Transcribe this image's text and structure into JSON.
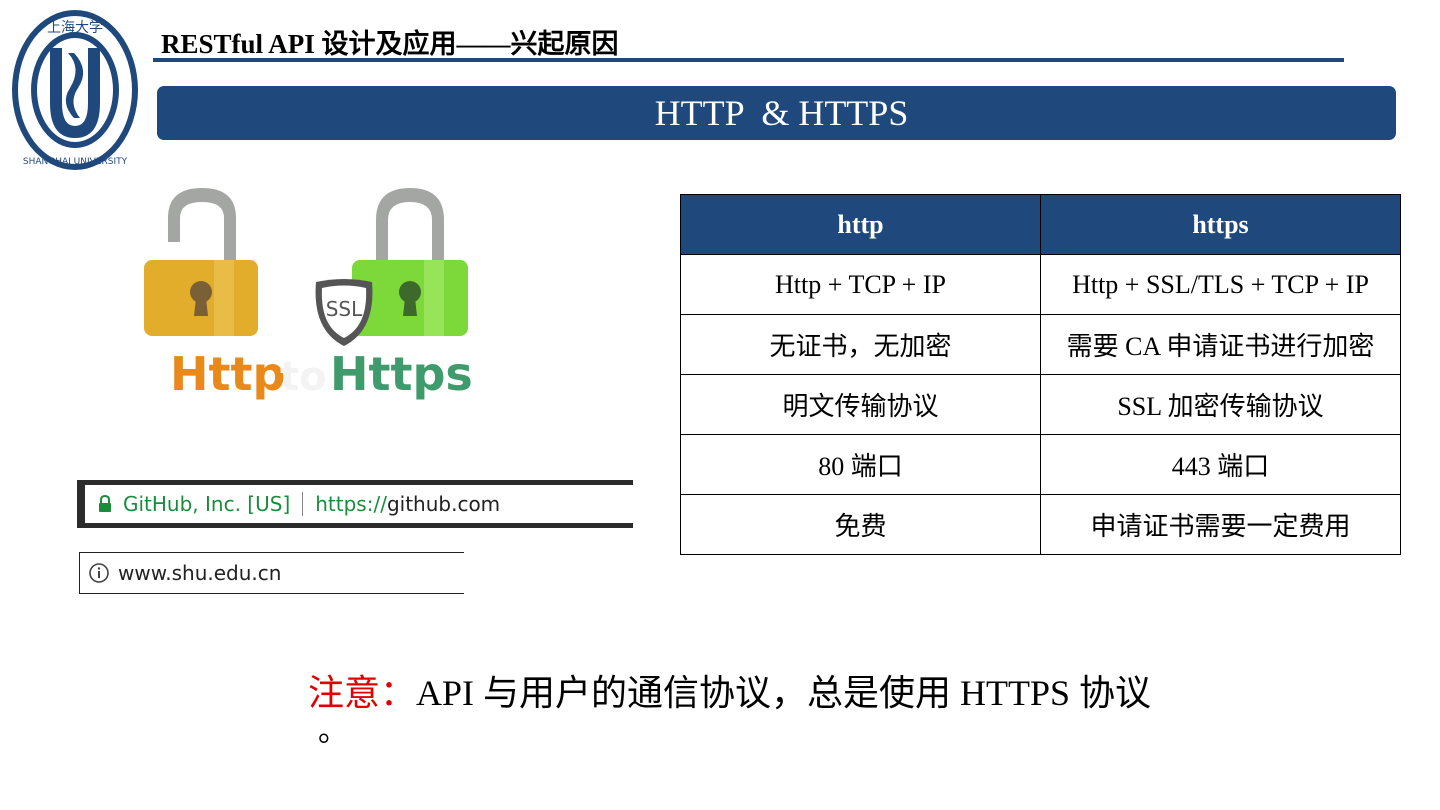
{
  "header": {
    "title": "RESTful API 设计及应用——兴起原因",
    "logo_text_top": "上海大学",
    "logo_text_bottom": "SHANGHAI UNIVERSITY"
  },
  "banner": {
    "title": "HTTP  & HTTPS"
  },
  "illustration": {
    "http_label": "Http",
    "to_label": "to",
    "https_label": "Https",
    "ssl_label": "SSL"
  },
  "table": {
    "headers": [
      "http",
      "https"
    ],
    "rows": [
      [
        "Http + TCP + IP",
        "Http + SSL/TLS + TCP + IP"
      ],
      [
        "无证书，无加密",
        "需要 CA 申请证书进行加密"
      ],
      [
        "明文传输协议",
        "SSL 加密传输协议"
      ],
      [
        "80 端口",
        "443 端口"
      ],
      [
        "免费",
        "申请证书需要一定费用"
      ]
    ]
  },
  "browser_https": {
    "company": "GitHub, Inc. [US]",
    "url_scheme": "https://",
    "url_host": "github.com"
  },
  "browser_http": {
    "url": "www.shu.edu.cn"
  },
  "note": {
    "label": "注意：",
    "text": "API 与用户的通信协议，总是使用 HTTPS 协议",
    "end": "。"
  },
  "colors": {
    "primary": "#1f497d",
    "http_orange": "#e8891a",
    "https_green": "#3f9b6b",
    "note_red": "#e00000"
  }
}
